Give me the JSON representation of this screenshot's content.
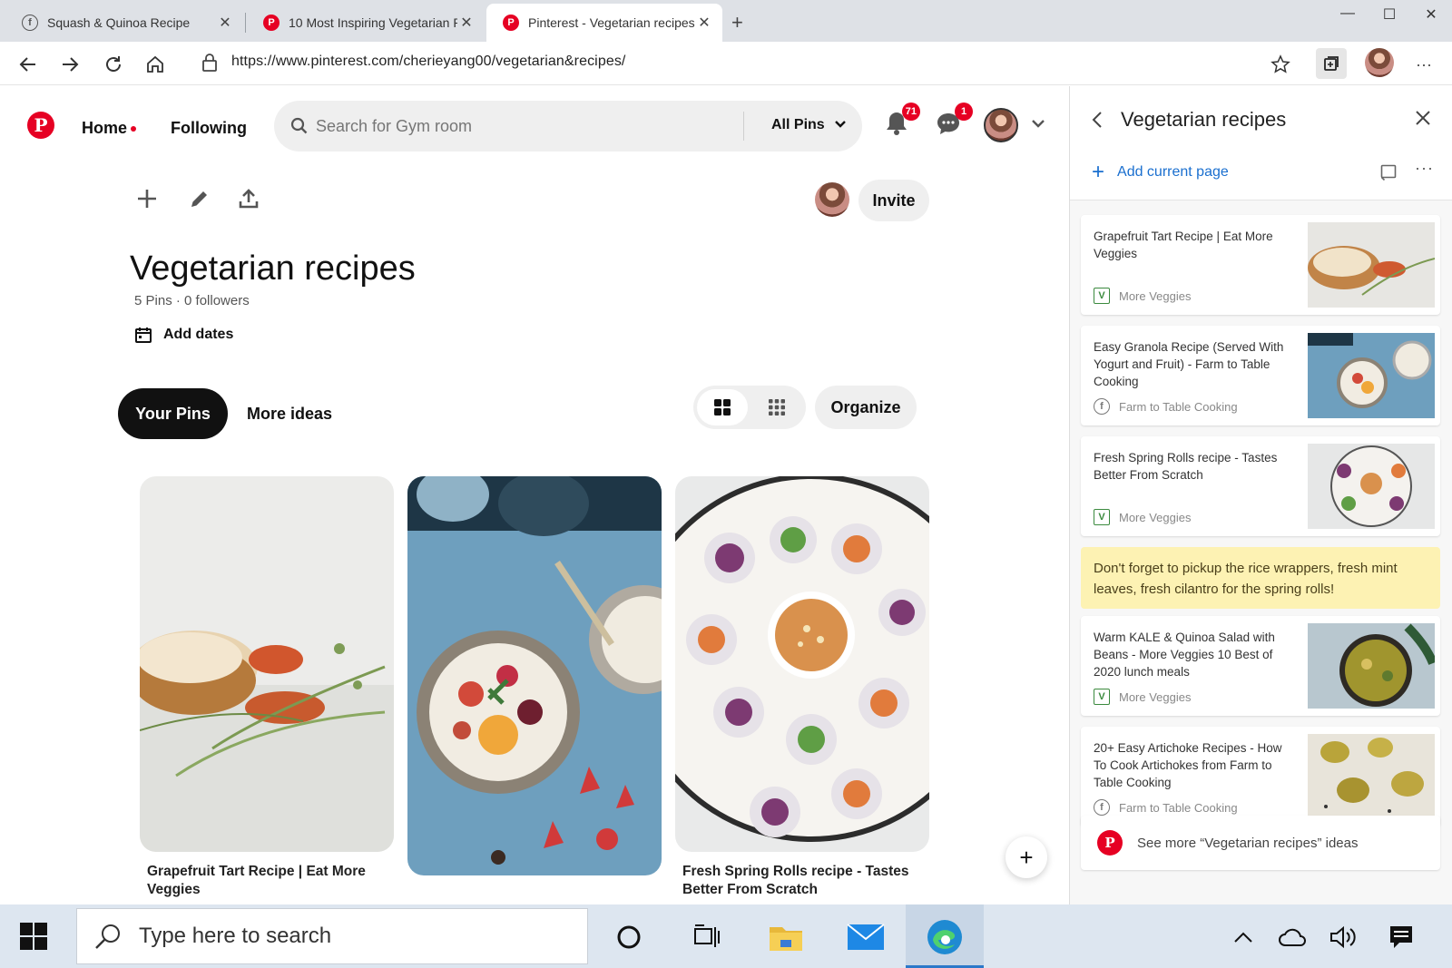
{
  "browser": {
    "tabs": [
      {
        "title": "Squash & Quinoa Recipe",
        "favicon": "f"
      },
      {
        "title": "10 Most Inspiring Vegetarian Re",
        "favicon": "P"
      },
      {
        "title": "Pinterest - Vegetarian recipes",
        "favicon": "P",
        "active": true
      }
    ],
    "url": "https://www.pinterest.com/cherieyang00/vegetarian&recipes/"
  },
  "header": {
    "logo": "P",
    "home_label": "Home",
    "following_label": "Following",
    "search_placeholder": "Search for Gym room",
    "filter_label": "All Pins",
    "notifications_count": "71",
    "messages_count": "1"
  },
  "board": {
    "invite_label": "Invite",
    "title": "Vegetarian recipes",
    "meta": "5 Pins · 0 followers",
    "add_dates_label": "Add dates",
    "tab_your_pins": "Your Pins",
    "tab_more_ideas": "More ideas",
    "organize_label": "Organize",
    "pins": [
      {
        "caption": "Grapefruit Tart Recipe | Eat More Veggies"
      },
      {
        "caption": ""
      },
      {
        "caption": "Fresh Spring Rolls recipe - Tastes Better From Scratch"
      }
    ]
  },
  "panel": {
    "title": "Vegetarian recipes",
    "add_current_page": "Add current page",
    "cards": [
      {
        "title": "Grapefruit Tart Recipe | Eat More Veggies",
        "source": "More Veggies",
        "source_icon": "V"
      },
      {
        "title": "Easy Granola Recipe (Served With Yogurt and Fruit) - Farm to Table Cooking",
        "source": "Farm to Table Cooking",
        "source_icon": "f"
      },
      {
        "title": "Fresh Spring Rolls recipe - Tastes Better From Scratch",
        "source": "More Veggies",
        "source_icon": "V"
      },
      {
        "title": "Warm KALE & Quinoa Salad with Beans - More Veggies 10 Best of 2020 lunch meals",
        "source": "More Veggies",
        "source_icon": "V"
      },
      {
        "title": "20+ Easy Artichoke Recipes - How To Cook Artichokes from Farm to Table Cooking",
        "source": "Farm to Table Cooking",
        "source_icon": "f"
      }
    ],
    "note": "Don't forget to pickup the rice wrappers, fresh mint leaves, fresh cilantro for the spring rolls!",
    "see_more": "See more “Vegetarian recipes” ideas"
  },
  "taskbar": {
    "search_placeholder": "Type here to search"
  },
  "colors": {
    "pinterest_red": "#e60023",
    "link_blue": "#1a6fcf",
    "note_yellow": "#fdf2b3"
  }
}
